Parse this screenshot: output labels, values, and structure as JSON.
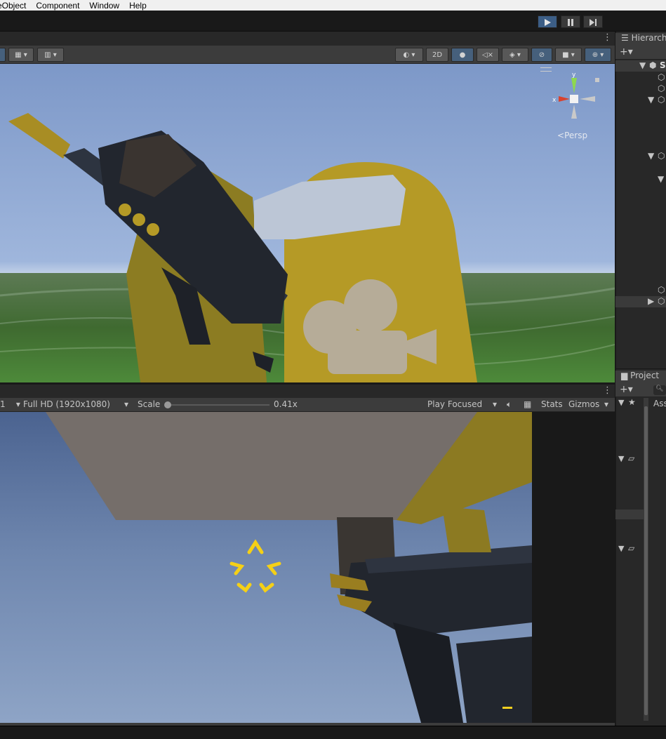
{
  "menu": [
    "eObject",
    "Component",
    "Window",
    "Help"
  ],
  "play_controls": [
    "play-icon",
    "pause-icon",
    "step-icon"
  ],
  "scene": {
    "toggle_2d": "2D",
    "persp_label": "Persp",
    "gizmo_x": "x",
    "gizmo_y": "y"
  },
  "game": {
    "resolution": "Full HD (1920x1080)",
    "scale_label": "Scale",
    "scale_value": "0.41x",
    "play_mode": "Play Focused",
    "stats": "Stats",
    "gizmos": "Gizmos",
    "display_fragment": "1"
  },
  "hierarchy": {
    "title": "Hierarch",
    "root_fragment": "S"
  },
  "project": {
    "title": "Project",
    "search_fragment": "Ass"
  },
  "colors": {
    "active_play": "#3c5e86",
    "panel": "#282828",
    "toolbar": "#3c3c3c",
    "character_yellow": "#b59a26"
  }
}
